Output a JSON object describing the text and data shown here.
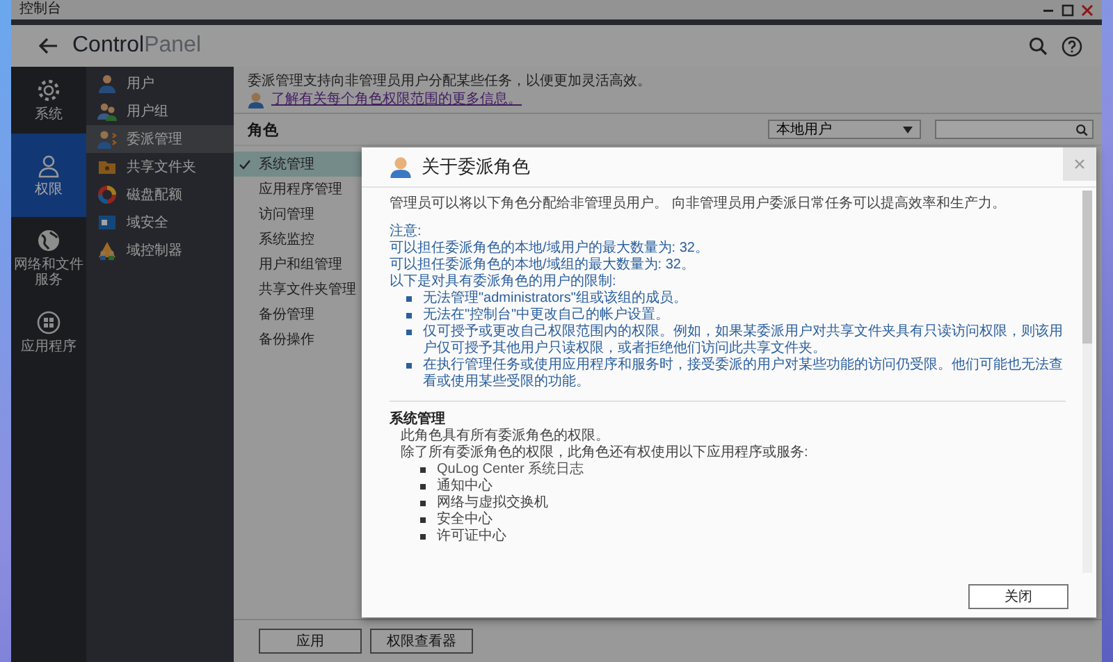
{
  "window": {
    "title": "控制台"
  },
  "header": {
    "title_primary": "Control",
    "title_secondary": "Panel"
  },
  "rail": [
    {
      "label": "系统",
      "selected": false
    },
    {
      "label": "权限",
      "selected": true
    },
    {
      "label": "网络和文件服务",
      "selected": false
    },
    {
      "label": "应用程序",
      "selected": false
    }
  ],
  "nav": [
    {
      "label": "用户",
      "selected": false
    },
    {
      "label": "用户组",
      "selected": false
    },
    {
      "label": "委派管理",
      "selected": true
    },
    {
      "label": "共享文件夹",
      "selected": false
    },
    {
      "label": "磁盘配额",
      "selected": false
    },
    {
      "label": "域安全",
      "selected": false
    },
    {
      "label": "域控制器",
      "selected": false
    }
  ],
  "content": {
    "description": "委派管理支持向非管理员用户分配某些任务，以便更加灵活高效。",
    "link": "了解有关每个角色权限范围的更多信息。",
    "section_title": "角色",
    "user_type": "本地用户",
    "roles": [
      {
        "label": "系统管理",
        "selected": true
      },
      {
        "label": "应用程序管理",
        "selected": false
      },
      {
        "label": "访问管理",
        "selected": false
      },
      {
        "label": "系统监控",
        "selected": false
      },
      {
        "label": "用户和组管理",
        "selected": false
      },
      {
        "label": "共享文件夹管理",
        "selected": false
      },
      {
        "label": "备份管理",
        "selected": false
      },
      {
        "label": "备份操作",
        "selected": false
      }
    ],
    "buttons": [
      "应用",
      "权限查看器"
    ]
  },
  "modal": {
    "title": "关于委派角色",
    "intro": "管理员可以将以下角色分配给非管理员用户。 向非管理员用户委派日常任务可以提高效率和生产力。",
    "note_heading": "注意:",
    "notes": [
      "可以担任委派角色的本地/域用户的最大数量为: 32。",
      "可以担任委派角色的本地/域组的最大数量为: 32。",
      "以下是对具有委派角色的用户的限制:"
    ],
    "restrictions": [
      "无法管理\"administrators\"组或该组的成员。",
      "无法在\"控制台\"中更改自己的帐户设置。",
      "仅可授予或更改自己权限范围内的权限。例如，如果某委派用户对共享文件夹具有只读访问权限，则该用户仅可授予其他用户只读权限，或者拒绝他们访问此共享文件夹。",
      "在执行管理任务或使用应用程序和服务时，接受委派的用户对某些功能的访问仍受限。他们可能也无法查看或使用某些受限的功能。"
    ],
    "section": {
      "title": "系统管理",
      "lines": [
        "此角色具有所有委派角色的权限。",
        "除了所有委派角色的权限，此角色还有权使用以下应用程序或服务:"
      ],
      "items": [
        "QuLog Center 系统日志",
        "通知中心",
        "网络与虚拟交换机",
        "安全中心",
        "许可证中心"
      ]
    },
    "close_button": "关闭"
  }
}
